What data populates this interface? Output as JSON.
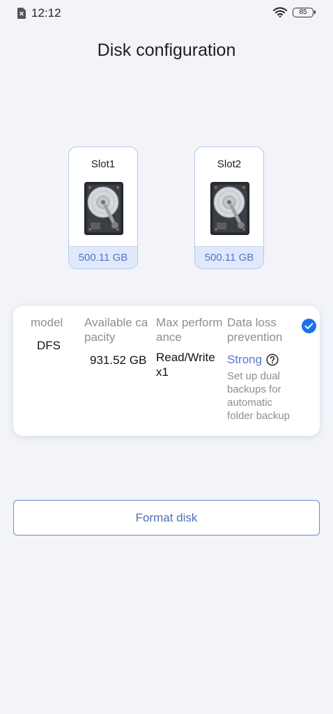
{
  "status_bar": {
    "time": "12:12",
    "battery": "85"
  },
  "page": {
    "title": "Disk configuration"
  },
  "slots": [
    {
      "name": "Slot1",
      "size": "500.11 GB"
    },
    {
      "name": "Slot2",
      "size": "500.11 GB"
    }
  ],
  "config_card": {
    "model": {
      "header": "model",
      "value": "DFS"
    },
    "capacity": {
      "header": "Available capacity",
      "value": "931.52 GB"
    },
    "performance": {
      "header": "Max performance",
      "value": "Read/Write x1"
    },
    "protection": {
      "header": "Data loss prevention",
      "level": "Strong",
      "description": "Set up dual backups for automatic folder backup"
    },
    "selected": true
  },
  "actions": {
    "format_label": "Format disk"
  },
  "colors": {
    "accent": "#1a73e8",
    "link": "#5578c8",
    "background": "#f2f4f9"
  }
}
